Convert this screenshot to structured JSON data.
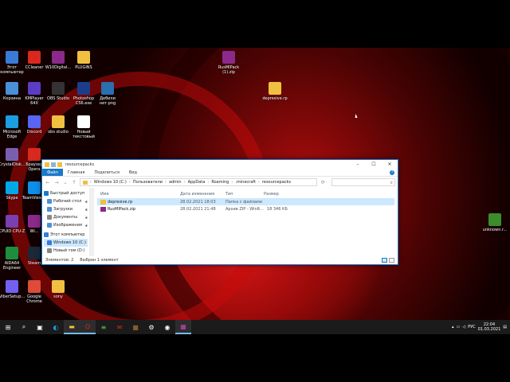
{
  "desktop": {
    "icons": [
      {
        "label": "Этот компьютер",
        "icon": "computer-icon",
        "color": "#3a7bd5"
      },
      {
        "label": "CCleaner",
        "icon": "ccleaner-icon",
        "color": "#d9281e"
      },
      {
        "label": "W10Digital...",
        "icon": "winrar-icon",
        "color": "#8b2a8a"
      },
      {
        "label": "PLUGINS",
        "icon": "folder-icon",
        "color": "#f0c040"
      },
      {
        "label": "RusMIPack (1).zip",
        "icon": "winrar-icon",
        "color": "#8b2a8a"
      },
      {
        "label": "Корзина",
        "icon": "recycle-bin-icon",
        "color": "#4a90d9"
      },
      {
        "label": "KMPlayer 64X",
        "icon": "kmplayer-icon",
        "color": "#5b3cc4"
      },
      {
        "label": "OBS Studio",
        "icon": "obs-icon",
        "color": "#333333"
      },
      {
        "label": "Photoshop CS6.exe",
        "icon": "photoshop-icon",
        "color": "#1b3e8c"
      },
      {
        "label": "Дебили нет.png",
        "icon": "image-icon",
        "color": "#2a6fb0"
      },
      {
        "label": "depresive.rp",
        "icon": "file-icon",
        "color": "#f0c040"
      },
      {
        "label": "Microsoft Edge",
        "icon": "edge-icon",
        "color": "#1b9de2"
      },
      {
        "label": "Discord",
        "icon": "discord-icon",
        "color": "#5865f2"
      },
      {
        "label": "obs studio",
        "icon": "folder-icon",
        "color": "#f0c040"
      },
      {
        "label": "Новый текстовый ...",
        "icon": "text-file-icon",
        "color": "#ffffff"
      },
      {
        "label": "CrystalDisk...",
        "icon": "crystaldisk-icon",
        "color": "#7a5fb0"
      },
      {
        "label": "Браузер Opera",
        "icon": "opera-icon",
        "color": "#d9281e"
      },
      {
        "label": "Skype",
        "icon": "skype-icon",
        "color": "#00a9e6"
      },
      {
        "label": "TeamViewer",
        "icon": "teamviewer-icon",
        "color": "#0e8ee9"
      },
      {
        "label": "CPUID CPU-Z",
        "icon": "cpuz-icon",
        "color": "#7a3fb0"
      },
      {
        "label": "Wi...",
        "icon": "winrar-icon",
        "color": "#8b2a8a"
      },
      {
        "label": "AIDA64 Engineer",
        "icon": "aida64-icon",
        "color": "#1e8e3e"
      },
      {
        "label": "Steam",
        "icon": "steam-icon",
        "color": "#1b2838"
      },
      {
        "label": "ViberSetup...",
        "icon": "viber-icon",
        "color": "#7360f2"
      },
      {
        "label": "Google Chrome",
        "icon": "chrome-icon",
        "color": "#dd4b39"
      },
      {
        "label": "sony",
        "icon": "folder-icon",
        "color": "#f0c040"
      },
      {
        "label": "unknown.r...",
        "icon": "minecraft-icon",
        "color": "#3c8c2c"
      }
    ]
  },
  "explorer": {
    "title": "resourcepacks",
    "ribbon": {
      "file": "Файл",
      "home": "Главная",
      "share": "Поделиться",
      "view": "Вид"
    },
    "address_parts": [
      "Windows 10 (C:)",
      "Пользователи",
      "admin",
      "AppData",
      "Roaming",
      ".minecraft",
      "resourcepacks"
    ],
    "nav_items": [
      {
        "label": "Быстрый доступ",
        "color": "#1979ca",
        "pin": ""
      },
      {
        "label": "Рабочий стол",
        "color": "#4a90d9",
        "pin": "📌"
      },
      {
        "label": "Загрузки",
        "color": "#4a90d9",
        "pin": "📌"
      },
      {
        "label": "Документы",
        "color": "#888888",
        "pin": "📌"
      },
      {
        "label": "Изображения",
        "color": "#4a90d9",
        "pin": "📌"
      },
      {
        "label": "Этот компьютер",
        "color": "#3a7bd5",
        "pin": ""
      },
      {
        "label": "Windows 10 (C:)",
        "color": "#3a7bd5",
        "pin": ""
      },
      {
        "label": "Новый том (D:)",
        "color": "#888888",
        "pin": ""
      }
    ],
    "columns": {
      "name": "Имя",
      "date": "Дата изменения",
      "type": "Тип",
      "size": "Размер"
    },
    "files": [
      {
        "name": "depresive.rp",
        "date": "28.02.2021 18:03",
        "type": "Папка с файлами",
        "size": "",
        "icon": "folder-icon"
      },
      {
        "name": "RusMIPack.zip",
        "date": "28.02.2021 21:48",
        "type": "Архив ZIP - WinR...",
        "size": "18 346 КБ",
        "icon": "winrar-icon"
      }
    ],
    "status": {
      "count": "Элементов: 2",
      "selected": "Выбран 1 элемент"
    }
  },
  "taskbar": {
    "items": [
      "windows-start-icon",
      "search-icon",
      "task-view-icon",
      "edge-icon",
      "explorer-icon",
      "opera-icon",
      "notepad-icon",
      "mail-icon",
      "minecraft-icon",
      "settings-icon",
      "obs-icon",
      "winrar-icon"
    ],
    "lang": "РУС",
    "time": "22:04",
    "date": "01.03.2021"
  }
}
